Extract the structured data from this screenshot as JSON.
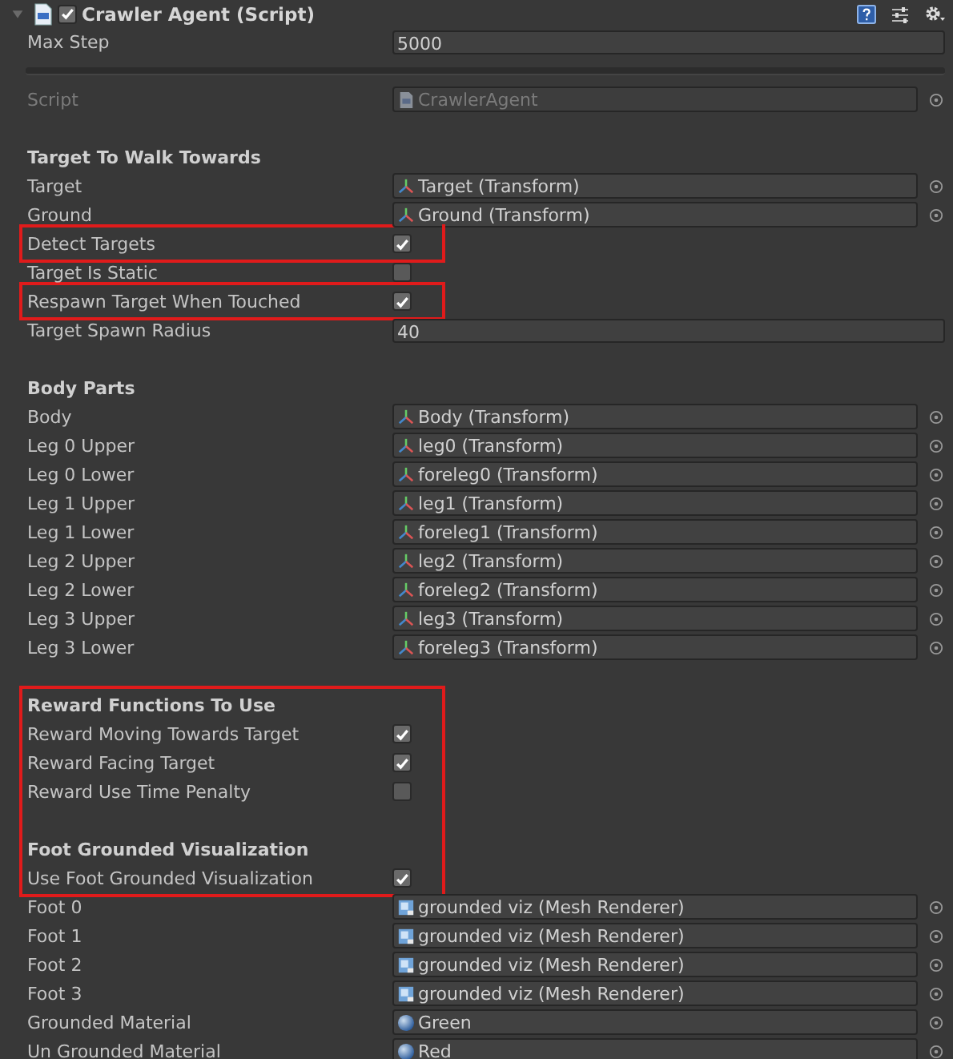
{
  "component": {
    "title": "Crawler Agent (Script)",
    "expanded": true,
    "enabled": true
  },
  "items": [
    {
      "kind": "number",
      "label": "Max Step",
      "value": "5000",
      "disabled": false,
      "highlighted": false
    },
    {
      "kind": "separator",
      "highlighted": false
    },
    {
      "kind": "script_object",
      "label": "Script",
      "value": "CrawlerAgent",
      "disabled": true,
      "highlighted": false
    },
    {
      "kind": "header",
      "label": "Target To Walk Towards",
      "highlighted": false
    },
    {
      "kind": "transform_object",
      "label": "Target",
      "value": "Target (Transform)",
      "disabled": false,
      "highlighted": false
    },
    {
      "kind": "transform_object",
      "label": "Ground",
      "value": "Ground (Transform)",
      "disabled": false,
      "highlighted": false
    },
    {
      "kind": "checkbox",
      "label": "Detect Targets",
      "checked": true,
      "disabled": false,
      "highlighted": true
    },
    {
      "kind": "checkbox",
      "label": "Target Is Static",
      "checked": false,
      "disabled": false,
      "highlighted": false
    },
    {
      "kind": "checkbox",
      "label": "Respawn Target When Touched",
      "checked": true,
      "disabled": false,
      "highlighted": true
    },
    {
      "kind": "number",
      "label": "Target Spawn Radius",
      "value": "40",
      "disabled": false,
      "highlighted": false
    },
    {
      "kind": "header",
      "label": "Body Parts",
      "highlighted": false
    },
    {
      "kind": "transform_object",
      "label": "Body",
      "value": "Body (Transform)",
      "disabled": false,
      "highlighted": false
    },
    {
      "kind": "transform_object",
      "label": "Leg 0 Upper",
      "value": "leg0 (Transform)",
      "disabled": false,
      "highlighted": false
    },
    {
      "kind": "transform_object",
      "label": "Leg 0 Lower",
      "value": "foreleg0 (Transform)",
      "disabled": false,
      "highlighted": false
    },
    {
      "kind": "transform_object",
      "label": "Leg 1 Upper",
      "value": "leg1 (Transform)",
      "disabled": false,
      "highlighted": false
    },
    {
      "kind": "transform_object",
      "label": "Leg 1 Lower",
      "value": "foreleg1 (Transform)",
      "disabled": false,
      "highlighted": false
    },
    {
      "kind": "transform_object",
      "label": "Leg 2 Upper",
      "value": "leg2 (Transform)",
      "disabled": false,
      "highlighted": false
    },
    {
      "kind": "transform_object",
      "label": "Leg 2 Lower",
      "value": "foreleg2 (Transform)",
      "disabled": false,
      "highlighted": false
    },
    {
      "kind": "transform_object",
      "label": "Leg 3 Upper",
      "value": "leg3 (Transform)",
      "disabled": false,
      "highlighted": false
    },
    {
      "kind": "transform_object",
      "label": "Leg 3 Lower",
      "value": "foreleg3 (Transform)",
      "disabled": false,
      "highlighted": false
    },
    {
      "kind": "header",
      "label": "Reward Functions To Use",
      "highlighted": true
    },
    {
      "kind": "checkbox",
      "label": "Reward Moving Towards Target",
      "checked": true,
      "disabled": false,
      "highlighted": true
    },
    {
      "kind": "checkbox",
      "label": "Reward Facing Target",
      "checked": true,
      "disabled": false,
      "highlighted": true
    },
    {
      "kind": "checkbox",
      "label": "Reward Use Time Penalty",
      "checked": false,
      "disabled": false,
      "highlighted": true
    },
    {
      "kind": "header",
      "label": "Foot Grounded Visualization",
      "highlighted": true
    },
    {
      "kind": "checkbox",
      "label": "Use Foot Grounded Visualization",
      "checked": true,
      "disabled": false,
      "highlighted": true
    },
    {
      "kind": "mesh_object",
      "label": "Foot 0",
      "value": "grounded viz (Mesh Renderer)",
      "disabled": false,
      "highlighted": false
    },
    {
      "kind": "mesh_object",
      "label": "Foot 1",
      "value": "grounded viz (Mesh Renderer)",
      "disabled": false,
      "highlighted": false
    },
    {
      "kind": "mesh_object",
      "label": "Foot 2",
      "value": "grounded viz (Mesh Renderer)",
      "disabled": false,
      "highlighted": false
    },
    {
      "kind": "mesh_object",
      "label": "Foot 3",
      "value": "grounded viz (Mesh Renderer)",
      "disabled": false,
      "highlighted": false
    },
    {
      "kind": "material_object",
      "label": "Grounded Material",
      "value": "Green",
      "disabled": false,
      "highlighted": false
    },
    {
      "kind": "material_object",
      "label": "Un Grounded Material",
      "value": "Red",
      "disabled": false,
      "highlighted": false
    }
  ]
}
